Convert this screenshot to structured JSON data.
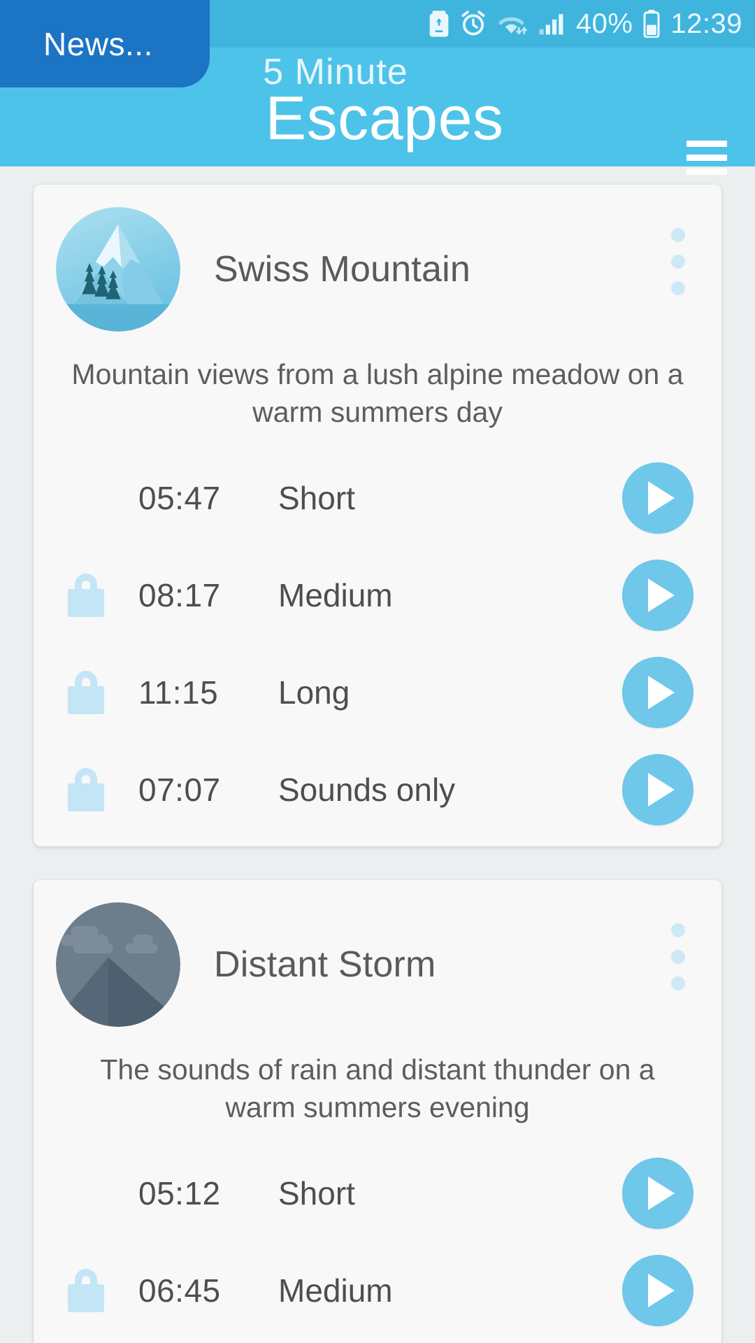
{
  "status_bar": {
    "time": "12:39",
    "battery_percent": "40%",
    "icons": [
      "battery-saver-icon",
      "alarm-icon",
      "wifi-icon",
      "cellular-signal-icon",
      "battery-icon"
    ]
  },
  "toast": {
    "label": "News...",
    "bg_color": "#1b74c4"
  },
  "app_bar": {
    "title_line1": "5 Minute",
    "title_line2": "Escapes",
    "menu_icon": "hamburger-menu-icon",
    "bg_color": "#4ec3ea"
  },
  "colors": {
    "accent": "#4ec3ea",
    "play_button": "#6fc7ea",
    "lock": "#c3e5f6",
    "dots": "#cde9f6",
    "card_bg": "#f8f8f8",
    "text": "#4e4e4e"
  },
  "cards": [
    {
      "avatar": "swiss-mountain-avatar",
      "title": "Swiss Mountain",
      "description": "Mountain views from a lush alpine meadow on a warm summers day",
      "menu_icon": "overflow-menu-icon",
      "tracks": [
        {
          "locked": false,
          "duration": "05:47",
          "label": "Short",
          "action": "play-button"
        },
        {
          "locked": true,
          "duration": "08:17",
          "label": "Medium",
          "action": "play-button"
        },
        {
          "locked": true,
          "duration": "11:15",
          "label": "Long",
          "action": "play-button"
        },
        {
          "locked": true,
          "duration": "07:07",
          "label": "Sounds only",
          "action": "play-button"
        }
      ]
    },
    {
      "avatar": "distant-storm-avatar",
      "title": "Distant Storm",
      "description": "The sounds of rain and distant thunder on a warm summers evening",
      "menu_icon": "overflow-menu-icon",
      "tracks": [
        {
          "locked": false,
          "duration": "05:12",
          "label": "Short",
          "action": "play-button"
        },
        {
          "locked": true,
          "duration": "06:45",
          "label": "Medium",
          "action": "play-button"
        }
      ]
    }
  ]
}
